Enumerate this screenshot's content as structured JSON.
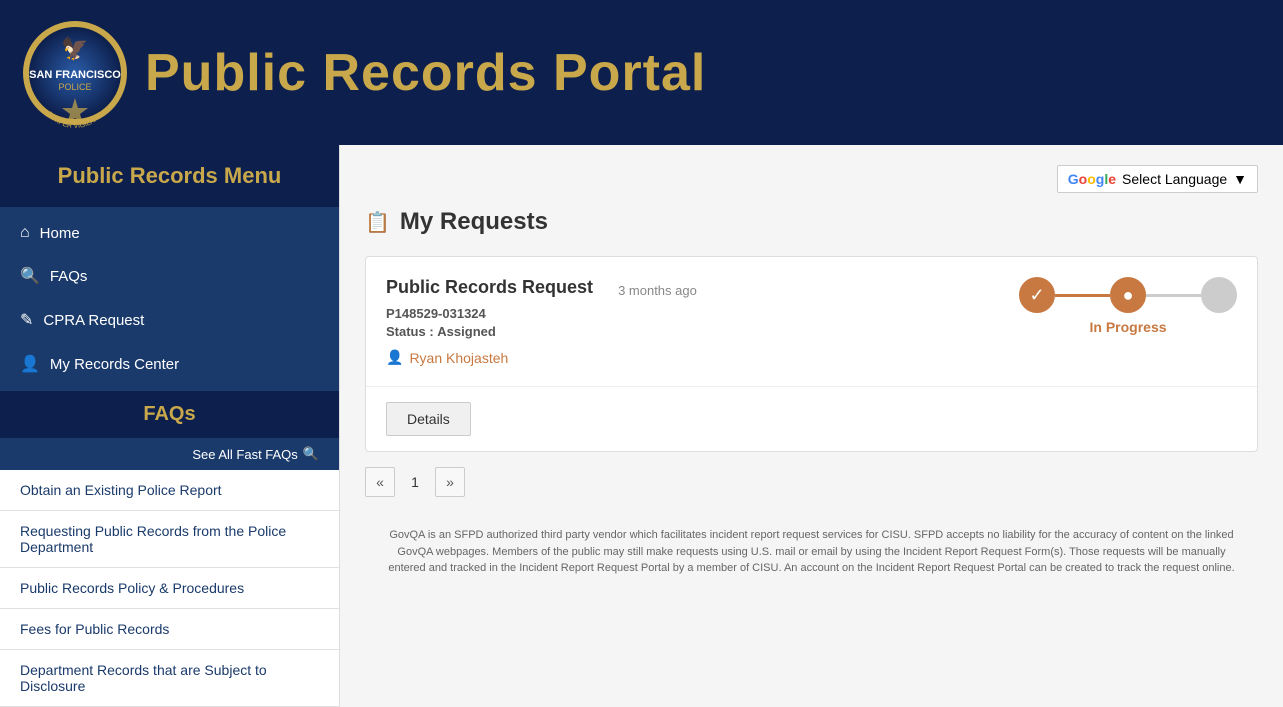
{
  "header": {
    "title": "Public Records Portal",
    "logo_alt": "San Francisco Police Badge"
  },
  "sidebar": {
    "menu_title": "Public Records Menu",
    "nav_items": [
      {
        "label": "Home",
        "icon": "⌂"
      },
      {
        "label": "FAQs",
        "icon": "🔍"
      },
      {
        "label": "CPRA Request",
        "icon": "✎"
      },
      {
        "label": "My Records Center",
        "icon": "👤"
      }
    ],
    "faqs_title": "FAQs",
    "see_all_label": "See All Fast FAQs",
    "faq_items": [
      "Obtain an Existing Police Report",
      "Requesting Public Records from the Police Department",
      "Public Records Policy & Procedures",
      "Fees for Public Records",
      "Department Records that are Subject to Disclosure"
    ]
  },
  "translate": {
    "label": "Select Language",
    "dropdown_icon": "▼"
  },
  "my_requests": {
    "title": "My Requests",
    "icon": "📋",
    "requests": [
      {
        "type": "Public Records Request",
        "time_ago": "3 months ago",
        "id": "P148529-031324",
        "status_label": "Status :",
        "status_value": "Assigned",
        "user": "Ryan Khojasteh",
        "progress_label": "In Progress"
      }
    ],
    "details_btn": "Details",
    "pagination": {
      "prev": "«",
      "page": "1",
      "next": "»"
    }
  },
  "footer": {
    "text": "GovQA is an SFPD authorized third party vendor which facilitates incident report request services for CISU. SFPD accepts no liability for the accuracy of content on the linked GovQA webpages. Members of the public may still make requests using U.S. mail or email by using the Incident Report Request Form(s). Those requests will be manually entered and tracked in the Incident Report Request Portal by a member of CISU. An account on the Incident Report Request Portal can be created to track the request online."
  }
}
